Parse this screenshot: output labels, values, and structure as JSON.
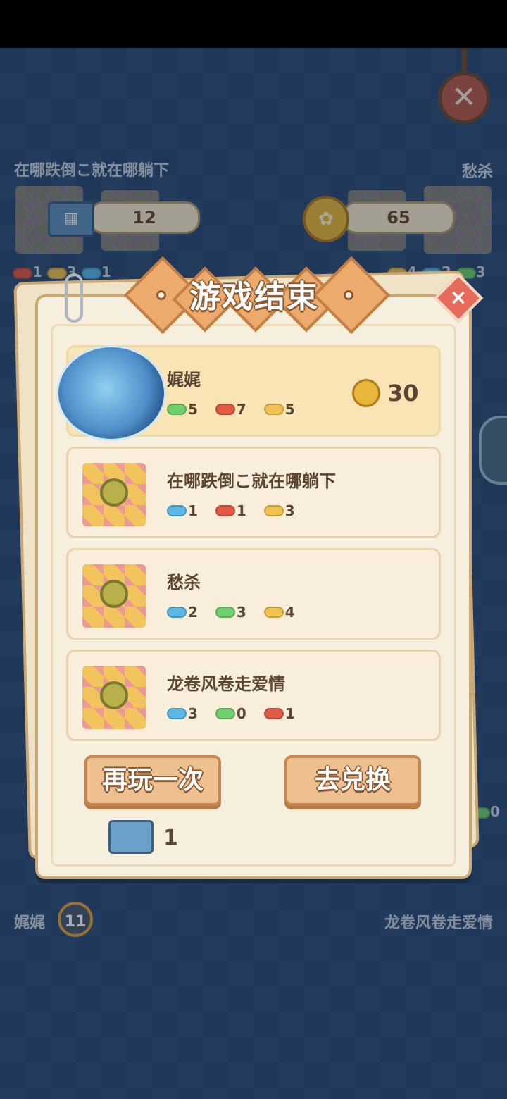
{
  "top_left_player": {
    "name": "在哪跌倒こ就在哪躺下",
    "counter": "12",
    "dots": [
      {
        "color": "#e05a45",
        "n": "1"
      },
      {
        "color": "#f2c14e",
        "n": "3"
      },
      {
        "color": "#5bb7e6",
        "n": "1"
      }
    ]
  },
  "top_right_player": {
    "name": "愁杀",
    "counter": "65",
    "dots": [
      {
        "color": "#f2c14e",
        "n": "4"
      },
      {
        "color": "#5bb7e6",
        "n": "2"
      },
      {
        "color": "#6fd06b",
        "n": "3"
      }
    ]
  },
  "bottom_left_player": {
    "name": "娓娓",
    "count": "11"
  },
  "bottom_right_player": {
    "name": "龙卷风卷走爱情",
    "dot_value": "0"
  },
  "dialog": {
    "title": "游戏结束",
    "close_symbol": "×",
    "players": [
      {
        "name": "娓娓",
        "stats": [
          {
            "color": "green",
            "value": "5"
          },
          {
            "color": "red",
            "value": "7"
          },
          {
            "color": "yellow",
            "value": "5"
          }
        ],
        "reward": "30",
        "winner": true
      },
      {
        "name": "在哪跌倒こ就在哪躺下",
        "stats": [
          {
            "color": "blue",
            "value": "1"
          },
          {
            "color": "red",
            "value": "1"
          },
          {
            "color": "yellow",
            "value": "3"
          }
        ]
      },
      {
        "name": "愁杀",
        "stats": [
          {
            "color": "blue",
            "value": "2"
          },
          {
            "color": "green",
            "value": "3"
          },
          {
            "color": "yellow",
            "value": "4"
          }
        ]
      },
      {
        "name": "龙卷风卷走爱情",
        "stats": [
          {
            "color": "blue",
            "value": "3"
          },
          {
            "color": "green",
            "value": "0"
          },
          {
            "color": "red",
            "value": "1"
          }
        ]
      }
    ],
    "buttons": {
      "replay": "再玩一次",
      "exchange": "去兑换"
    },
    "ticket_count": "1"
  },
  "icons": {
    "ticket": "map-ticket-icon",
    "coin": "gold-coin-icon",
    "close": "close-icon"
  },
  "colors": {
    "blue": "#5bb7e6",
    "red": "#e05a45",
    "yellow": "#f2c14e",
    "green": "#6fd06b",
    "panel": "#f7efdd",
    "button": "#efc08f"
  }
}
